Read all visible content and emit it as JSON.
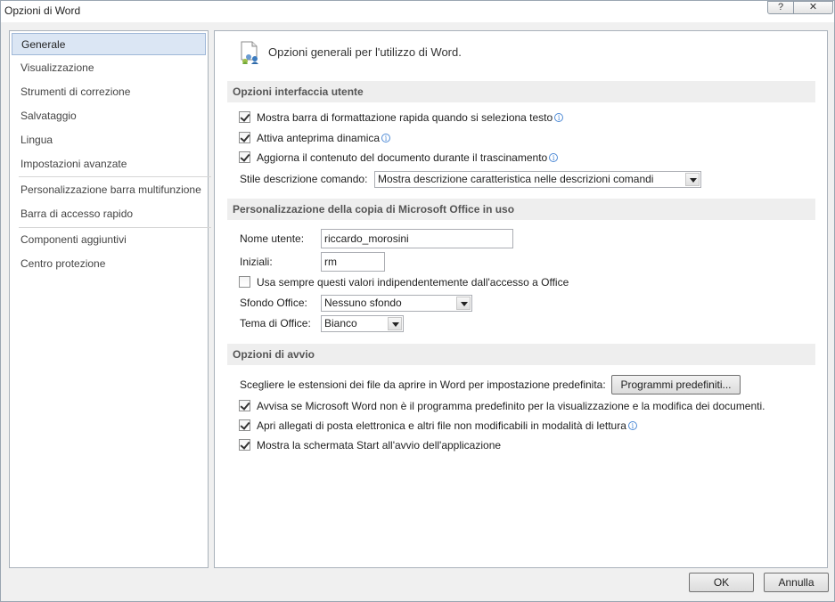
{
  "window": {
    "title": "Opzioni di Word",
    "help_glyph": "?",
    "close_glyph": "✕"
  },
  "sidebar": {
    "items": [
      {
        "label": "Generale"
      },
      {
        "label": "Visualizzazione"
      },
      {
        "label": "Strumenti di correzione"
      },
      {
        "label": "Salvataggio"
      },
      {
        "label": "Lingua"
      },
      {
        "label": "Impostazioni avanzate"
      },
      {
        "label": "Personalizzazione barra multifunzione"
      },
      {
        "label": "Barra di accesso rapido"
      },
      {
        "label": "Componenti aggiuntivi"
      },
      {
        "label": "Centro protezione"
      }
    ],
    "selected": "Generale"
  },
  "main": {
    "heading": "Opzioni generali per l'utilizzo di Word.",
    "heading_icon": "general-options-icon",
    "ui_section": {
      "title": "Opzioni interfaccia utente",
      "mini_toolbar": "Mostra barra di formattazione rapida quando si seleziona testo",
      "live_preview": "Attiva anteprima dinamica",
      "update_drag": "Aggiorna il contenuto del documento durante il trascinamento",
      "tooltip_label": "Stile descrizione comando:",
      "tooltip_value": "Mostra descrizione caratteristica nelle descrizioni comandi"
    },
    "personalize_section": {
      "title": "Personalizzazione della copia di Microsoft Office in uso",
      "username_label": "Nome utente:",
      "username_value": "riccardo_morosini",
      "initials_label": "Iniziali:",
      "initials_value": "rm",
      "always_use": "Usa sempre questi valori indipendentemente dall'accesso a Office",
      "background_label": "Sfondo Office:",
      "background_value": "Nessuno sfondo",
      "theme_label": "Tema di Office:",
      "theme_value": "Bianco"
    },
    "startup_section": {
      "title": "Opzioni di avvio",
      "extensions_text": "Scegliere le estensioni dei file da aprire in Word per impostazione predefinita:",
      "default_programs_button": "Programmi predefiniti...",
      "warn_default": "Avvisa se Microsoft Word non è il programma predefinito per la visualizzazione e la modifica dei documenti.",
      "open_attachments": "Apri allegati di posta elettronica e altri file non modificabili in modalità di lettura",
      "show_start": "Mostra la schermata Start all'avvio dell'applicazione"
    }
  },
  "footer": {
    "ok": "OK",
    "cancel": "Annulla"
  },
  "colors": {
    "selected_bg": "#dbe6f4",
    "info_icon": "#4f8bd6"
  }
}
